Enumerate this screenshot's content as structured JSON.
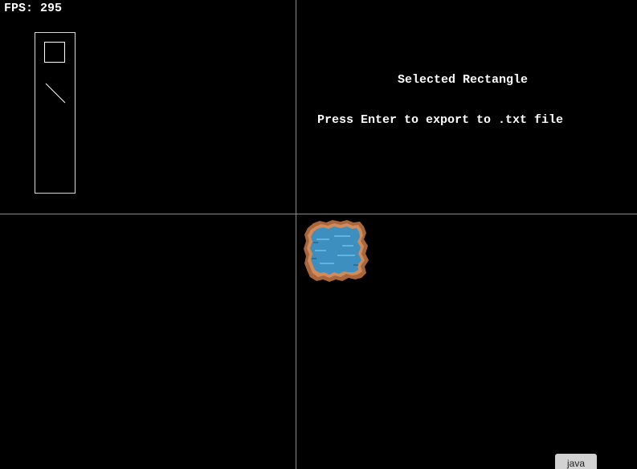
{
  "hud": {
    "fps_text": "FPS: 295"
  },
  "panel": {
    "selected_tool_text": "Selected Rectangle",
    "export_hint_text": "Press Enter to export to .txt file"
  },
  "toolbox": {
    "tools": [
      {
        "name": "rectangle",
        "icon": "rectangle-icon"
      },
      {
        "name": "line",
        "icon": "line-icon"
      }
    ]
  },
  "canvas": {
    "background_color": "#000000",
    "axis_color": "#8a8a8a",
    "placed_objects": [
      {
        "type": "pond-tile",
        "water_color": "#3d8fc0",
        "rim_color": "#a9663a"
      }
    ]
  },
  "taskbar": {
    "app_label": "java"
  }
}
